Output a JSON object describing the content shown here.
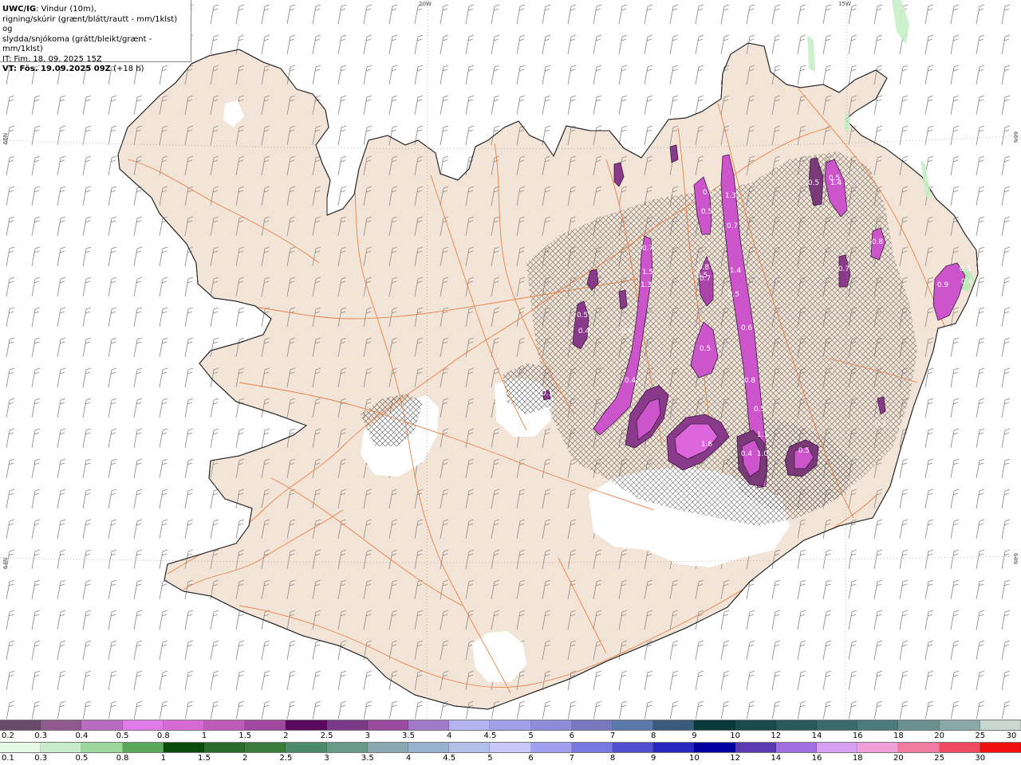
{
  "header": {
    "model": "UWC/IG",
    "line1": ": Vindur (10m),",
    "line2": "rigning/skúrir (grænt/blátt/rautt - mm/1klst) og",
    "line3": "slydda/snjókoma (grátt/bleikt/grænt - mm/1klst)",
    "init_time": "IT: Fim. 18. 09. 2025 15Z",
    "valid_time": "VT: Fös. 19.09.2025 09Z",
    "lead": "(+18 h)"
  },
  "graticule": {
    "lon_top": [
      "20W",
      "15W"
    ],
    "lat_left": [
      "66N",
      "64N"
    ],
    "lat_right": [
      "66N",
      "64N"
    ]
  },
  "precip_labels": [
    "0.5",
    "0.4",
    "0.5",
    "1.4",
    "0.5",
    "0.8",
    "0.7",
    "0.5",
    "0.5",
    "0.7",
    "0.8",
    "1.4",
    "0.7",
    "0.5",
    "0.5",
    "0.7",
    "1.5",
    "1.3",
    "0.9",
    "0.5",
    "1.3",
    "0.4",
    "0.5",
    "0.6",
    "0.6",
    "0.8",
    "0.5",
    "1.1",
    "1.6",
    "0.4",
    "1.0",
    "0.5",
    "0.3",
    "0.1",
    "0.4"
  ],
  "legend_top": {
    "ticks": [
      "0.2",
      "0.3",
      "0.4",
      "0.5",
      "0.8",
      "1",
      "1.5",
      "2",
      "2.5",
      "3",
      "3.5",
      "4",
      "4.5",
      "5",
      "6",
      "7",
      "8",
      "9",
      "10",
      "12",
      "14",
      "16",
      "18",
      "20",
      "25",
      "30"
    ],
    "colors": [
      "#6a4a6a",
      "#8e5a8e",
      "#b86cc0",
      "#e07ae8",
      "#d86ad4",
      "#c05ab8",
      "#a048a0",
      "#5a0a5a",
      "#7a3a86",
      "#9a4a9a",
      "#a07ac8",
      "#b4b4f0",
      "#a0a0e8",
      "#8c8cd8",
      "#7878c0",
      "#5a78a8",
      "#3a5a7a",
      "#0a3a3a",
      "#1a4a4a",
      "#2a5a5a",
      "#3a6a6a",
      "#4a7a7a",
      "#6a9090",
      "#8aa8a8",
      "#c8d8d0"
    ]
  },
  "legend_bottom": {
    "ticks": [
      "0.1",
      "0.3",
      "0.5",
      "0.8",
      "1",
      "1.5",
      "2",
      "2.5",
      "3",
      "3.5",
      "4",
      "4.5",
      "5",
      "6",
      "7",
      "8",
      "9",
      "10",
      "12",
      "14",
      "16",
      "18",
      "20",
      "25",
      "30"
    ],
    "colors": [
      "#e6f8e6",
      "#c8ecc8",
      "#9cd89c",
      "#5aa85a",
      "#0a4a0a",
      "#2a6a2a",
      "#3a7a3a",
      "#4a8a6a",
      "#6a9a8a",
      "#8aa8b0",
      "#9ab0d0",
      "#b0c0e8",
      "#c8c8f8",
      "#a0a0f0",
      "#7878e0",
      "#5050d0",
      "#2828c0",
      "#0000a0",
      "#5a3ab0",
      "#a070e0",
      "#d8a0f0",
      "#f0a0d8",
      "#f07aa0",
      "#f04a60",
      "#f01010"
    ]
  }
}
